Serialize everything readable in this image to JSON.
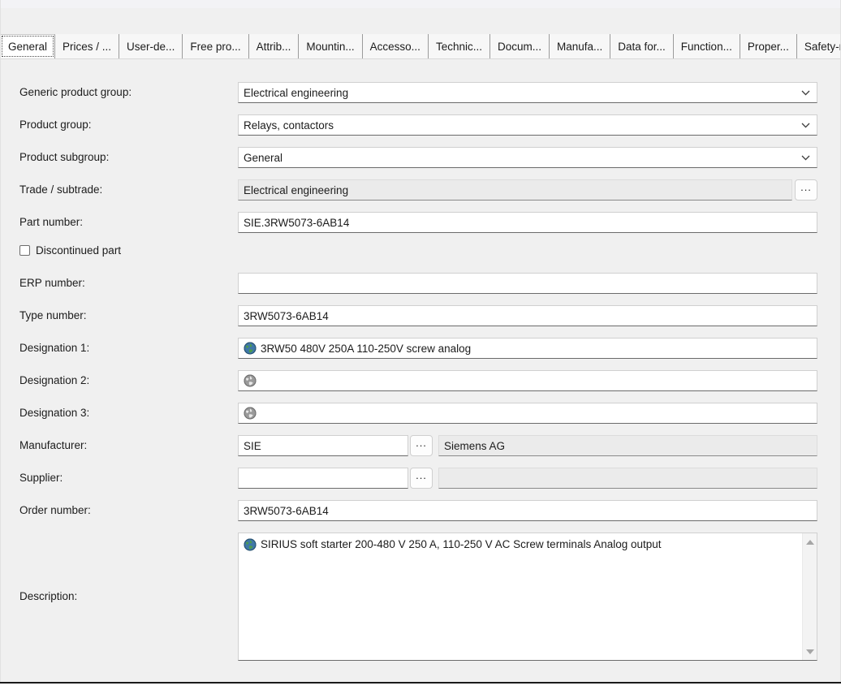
{
  "tabs": [
    {
      "label": "General",
      "selected": true
    },
    {
      "label": "Prices / ...",
      "selected": false
    },
    {
      "label": "User-de...",
      "selected": false
    },
    {
      "label": "Free pro...",
      "selected": false
    },
    {
      "label": "Attrib...",
      "selected": false
    },
    {
      "label": "Mountin...",
      "selected": false
    },
    {
      "label": "Accesso...",
      "selected": false
    },
    {
      "label": "Technic...",
      "selected": false
    },
    {
      "label": "Docum...",
      "selected": false
    },
    {
      "label": "Manufa...",
      "selected": false
    },
    {
      "label": "Data for...",
      "selected": false
    },
    {
      "label": "Function...",
      "selected": false
    },
    {
      "label": "Proper...",
      "selected": false
    },
    {
      "label": "Safety-r...",
      "selected": false
    }
  ],
  "form": {
    "generic_product_group": {
      "label": "Generic product group:",
      "value": "Electrical engineering"
    },
    "product_group": {
      "label": "Product group:",
      "value": "Relays, contactors"
    },
    "product_subgroup": {
      "label": "Product subgroup:",
      "value": "General"
    },
    "trade_subtrade": {
      "label": "Trade / subtrade:",
      "value": "Electrical engineering",
      "button_label": "..."
    },
    "part_number": {
      "label": "Part number:",
      "value": "SIE.3RW5073-6AB14"
    },
    "discontinued_part": {
      "label": "Discontinued part",
      "checked": false
    },
    "erp_number": {
      "label": "ERP number:",
      "value": ""
    },
    "type_number": {
      "label": "Type number:",
      "value": "3RW5073-6AB14"
    },
    "designation_1": {
      "label": "Designation 1:",
      "value": "3RW50 480V 250A 110-250V screw analog",
      "icon": "globe-icon",
      "icon_enabled": true
    },
    "designation_2": {
      "label": "Designation 2:",
      "value": "",
      "icon": "globe-icon",
      "icon_enabled": false
    },
    "designation_3": {
      "label": "Designation 3:",
      "value": "",
      "icon": "globe-icon",
      "icon_enabled": false
    },
    "manufacturer": {
      "label": "Manufacturer:",
      "code": "SIE",
      "button_label": "...",
      "name": "Siemens AG"
    },
    "supplier": {
      "label": "Supplier:",
      "code": "",
      "button_label": "...",
      "name": ""
    },
    "order_number": {
      "label": "Order number:",
      "value": "3RW5073-6AB14"
    },
    "description": {
      "label": "Description:",
      "value": "SIRIUS soft starter 200-480 V 250 A, 110-250 V AC Screw terminals Analog output",
      "icon": "globe-icon",
      "icon_enabled": true
    }
  },
  "colors": {
    "window_bg": "#f0f0f0",
    "field_bg": "#ffffff",
    "readonly_bg": "#ebebeb",
    "globe_blue": "#3f78a8",
    "globe_green": "#4e9b4e",
    "globe_gray": "#9a9a9a"
  }
}
